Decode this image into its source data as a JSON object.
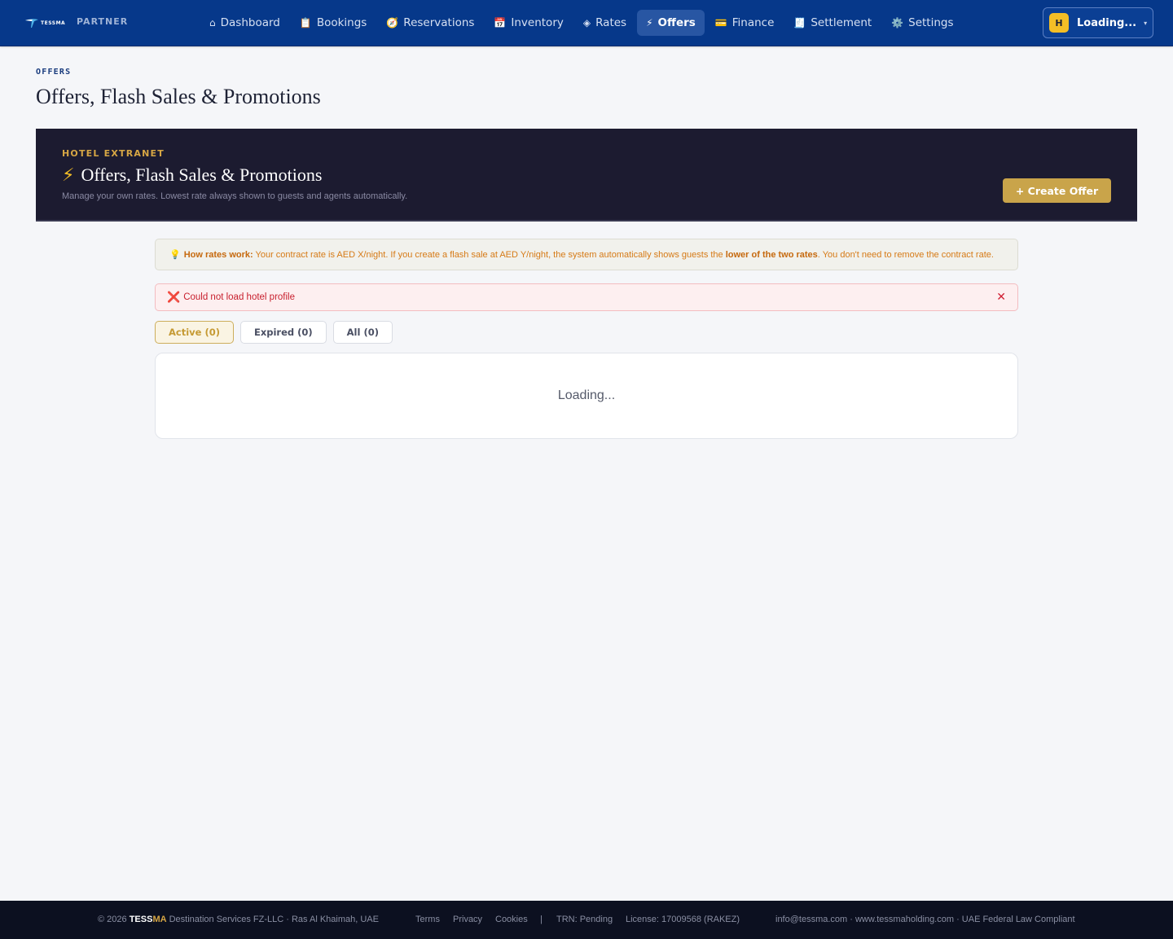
{
  "header": {
    "logo_text": "TESSMA",
    "partner_label": "PARTNER",
    "nav": [
      {
        "icon": "⌂",
        "icon_name": "home-icon",
        "label": "Dashboard"
      },
      {
        "icon": "📋",
        "icon_name": "clipboard-icon",
        "label": "Bookings"
      },
      {
        "icon": "🧭",
        "icon_name": "compass-icon",
        "label": "Reservations"
      },
      {
        "icon": "📅",
        "icon_name": "calendar-icon",
        "label": "Inventory"
      },
      {
        "icon": "◈",
        "icon_name": "diamond-icon",
        "label": "Rates"
      },
      {
        "icon": "⚡",
        "icon_name": "lightning-icon",
        "label": "Offers"
      },
      {
        "icon": "💳",
        "icon_name": "credit-card-icon",
        "label": "Finance"
      },
      {
        "icon": "🧾",
        "icon_name": "receipt-icon",
        "label": "Settlement"
      },
      {
        "icon": "⚙️",
        "icon_name": "gear-icon",
        "label": "Settings"
      }
    ],
    "active_nav": "Offers",
    "user": {
      "initial": "H",
      "name": "Loading...",
      "caret": "▾"
    }
  },
  "page": {
    "breadcrumb": "OFFERS",
    "title": "Offers, Flash Sales & Promotions"
  },
  "hero": {
    "kicker": "HOTEL EXTRANET",
    "icon": "⚡",
    "title": "Offers, Flash Sales & Promotions",
    "subtitle": "Manage your own rates. Lowest rate always shown to guests and agents automatically.",
    "create_button": "+ Create Offer"
  },
  "info": {
    "icon": "💡",
    "lead": "How rates work:",
    "text_1": " Your contract rate is AED X/night. If you create a flash sale at AED Y/night, the system automatically shows guests the ",
    "emphasis": "lower of the two rates",
    "text_2": ". You don't need to remove the contract rate."
  },
  "error": {
    "icon": "❌",
    "message": "Could not load hotel profile",
    "close": "✕"
  },
  "tabs": [
    {
      "label": "Active (0)"
    },
    {
      "label": "Expired (0)"
    },
    {
      "label": "All (0)"
    }
  ],
  "active_tab": 0,
  "content": {
    "loading": "Loading..."
  },
  "footer": {
    "copyright_prefix": "© 2026 ",
    "brand_a": "TESS",
    "brand_b": "MA",
    "company": " Destination Services FZ-LLC · Ras Al Khaimah, UAE",
    "links": [
      "Terms",
      "Privacy",
      "Cookies"
    ],
    "separator": "|",
    "trn": "TRN: Pending",
    "license": "License: 17009568 (RAKEZ)",
    "contact": "info@tessma.com · www.tessmaholding.com · UAE Federal Law Compliant"
  },
  "colors": {
    "nav_bg": "#06388a",
    "accent_gold": "#c9a44a",
    "hero_bg": "#1c1b30",
    "error_red": "#c8202e",
    "info_orange": "#d67a16"
  }
}
